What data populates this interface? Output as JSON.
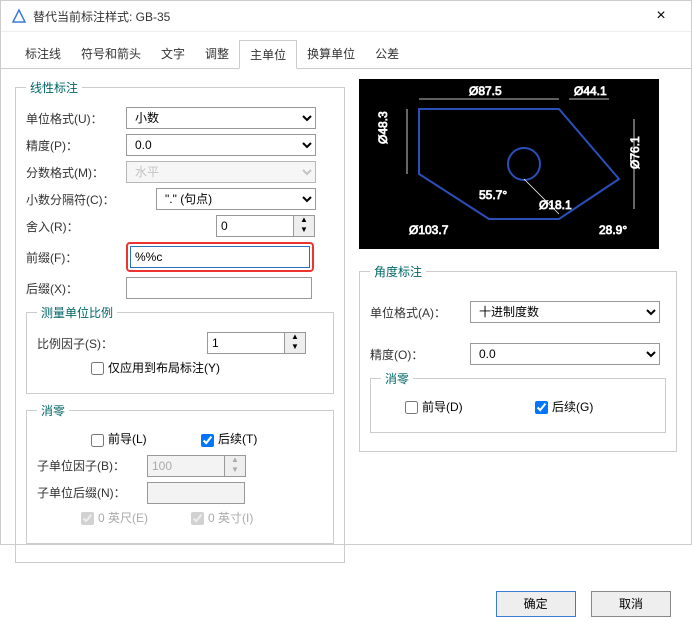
{
  "window": {
    "title": "替代当前标注样式: GB-35",
    "close": "×"
  },
  "tabs": [
    "标注线",
    "符号和箭头",
    "文字",
    "调整",
    "主单位",
    "换算单位",
    "公差"
  ],
  "active_tab": "主单位",
  "linear": {
    "legend": "线性标注",
    "unit_format_lbl": "单位格式(U)：",
    "unit_format": "小数",
    "precision_lbl": "精度(P)：",
    "precision": "0.0",
    "fraction_lbl": "分数格式(M)：",
    "fraction": "水平",
    "decimal_sep_lbl": "小数分隔符(C)：",
    "decimal_sep": "\".\" (句点)",
    "round_lbl": "舍入(R)：",
    "round": "0",
    "prefix_lbl": "前缀(F)：",
    "prefix": "%%c",
    "suffix_lbl": "后缀(X)：",
    "suffix": ""
  },
  "scale": {
    "legend": "测量单位比例",
    "factor_lbl": "比例因子(S)：",
    "factor": "1",
    "layout_only": "仅应用到布局标注(Y)"
  },
  "zero": {
    "legend": "消零",
    "leading": "前导(L)",
    "trailing": "后续(T)",
    "subunit_factor_lbl": "子单位因子(B)：",
    "subunit_factor": "100",
    "subunit_suffix_lbl": "子单位后缀(N)：",
    "subunit_suffix": "",
    "feet": "0 英尺(E)",
    "inches": "0 英寸(I)"
  },
  "angle": {
    "legend": "角度标注",
    "unit_format_lbl": "单位格式(A)：",
    "unit_format": "十进制度数",
    "precision_lbl": "精度(O)：",
    "precision": "0.0",
    "zero_legend": "消零",
    "leading": "前导(D)",
    "trailing": "后续(G)"
  },
  "preview": {
    "d1": "Ø87.5",
    "d2": "Ø44.1",
    "d3": "Ø48.3",
    "d4": "Ø76.1",
    "d5": "Ø103.7",
    "d6": "Ø18.1",
    "a1": "55.7°",
    "a2": "28.9°"
  },
  "footer": {
    "ok": "确定",
    "cancel": "取消"
  }
}
